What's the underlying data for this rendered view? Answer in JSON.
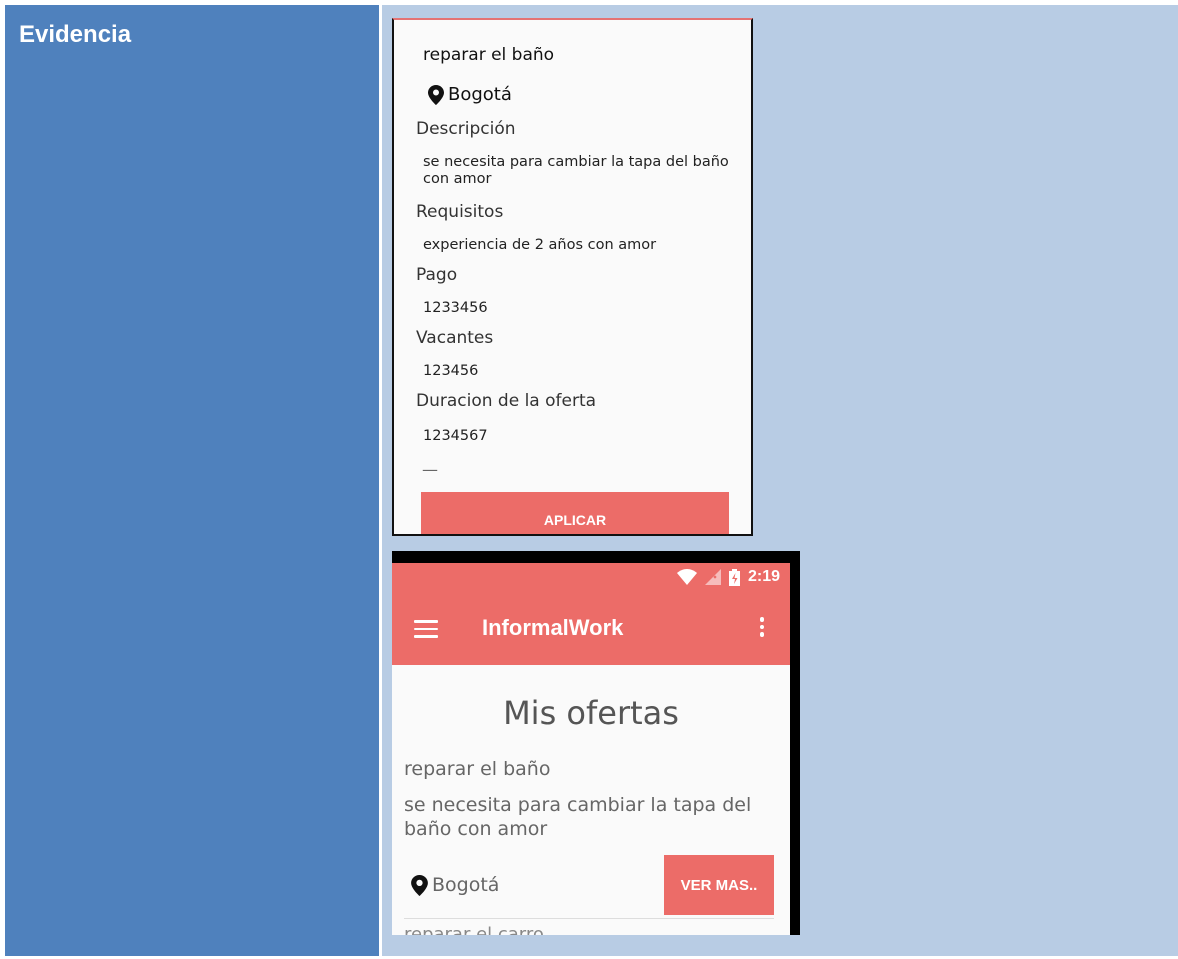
{
  "cell": {
    "label": "Evidencia"
  },
  "detail_screen": {
    "title": "reparar el baño",
    "location": "Bogotá",
    "description_header": "Descripción",
    "description": "se necesita para cambiar la tapa del baño con amor",
    "requirements_header": "Requisitos",
    "requirements": "experiencia de 2 años con amor",
    "payment_header": "Pago",
    "payment": "1233456",
    "vacancies_header": "Vacantes",
    "vacancies": "123456",
    "duration_header": "Duracion de la oferta",
    "duration": "1234567",
    "dash": "—",
    "apply_label": "APLICAR"
  },
  "list_screen": {
    "status_time": "2:19",
    "app_title": "InformalWork",
    "page_title": "Mis ofertas",
    "offer": {
      "title": "reparar el baño",
      "description": "se necesita para cambiar la tapa del baño con amor",
      "location": "Bogotá",
      "button_label": "VER MAS.."
    },
    "next_offer_title": "reparar el carro"
  },
  "colors": {
    "left_cell": "#4f81bd",
    "right_cell": "#b8cce4",
    "accent": "#ec6c68"
  }
}
